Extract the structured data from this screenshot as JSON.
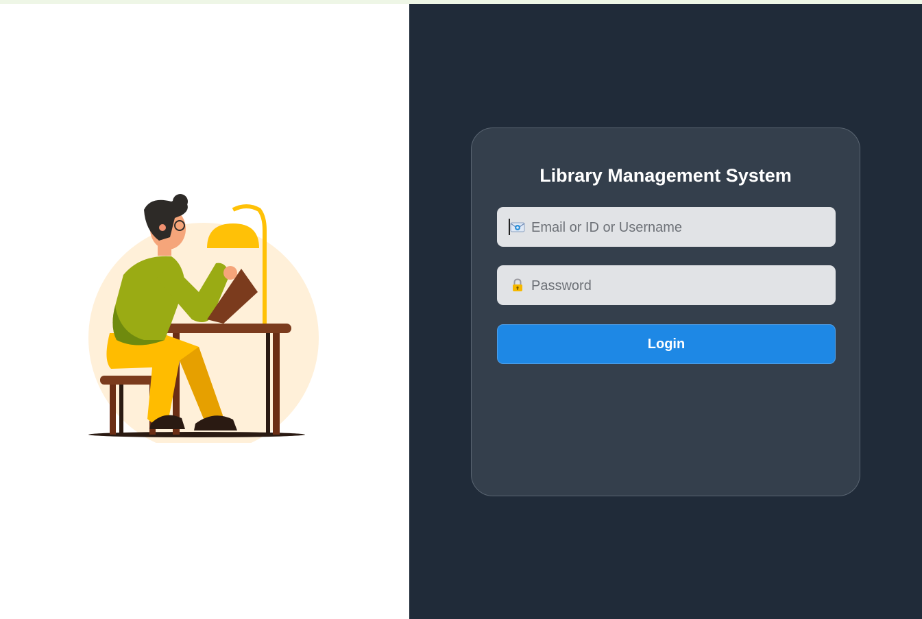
{
  "app": {
    "title": "Library Management System"
  },
  "login_form": {
    "email_placeholder": "Email or ID or Username",
    "email_value": "",
    "email_icon": "envelope-icon",
    "password_placeholder": "Password",
    "password_value": "",
    "password_icon": "lock-icon",
    "login_label": "Login"
  },
  "colors": {
    "page_background": "#202b39",
    "card_background": "#343f4c",
    "input_background": "#e1e3e6",
    "accent": "#1e88e5"
  },
  "illustration": {
    "subject": "person-reading-at-desk-illustration"
  }
}
